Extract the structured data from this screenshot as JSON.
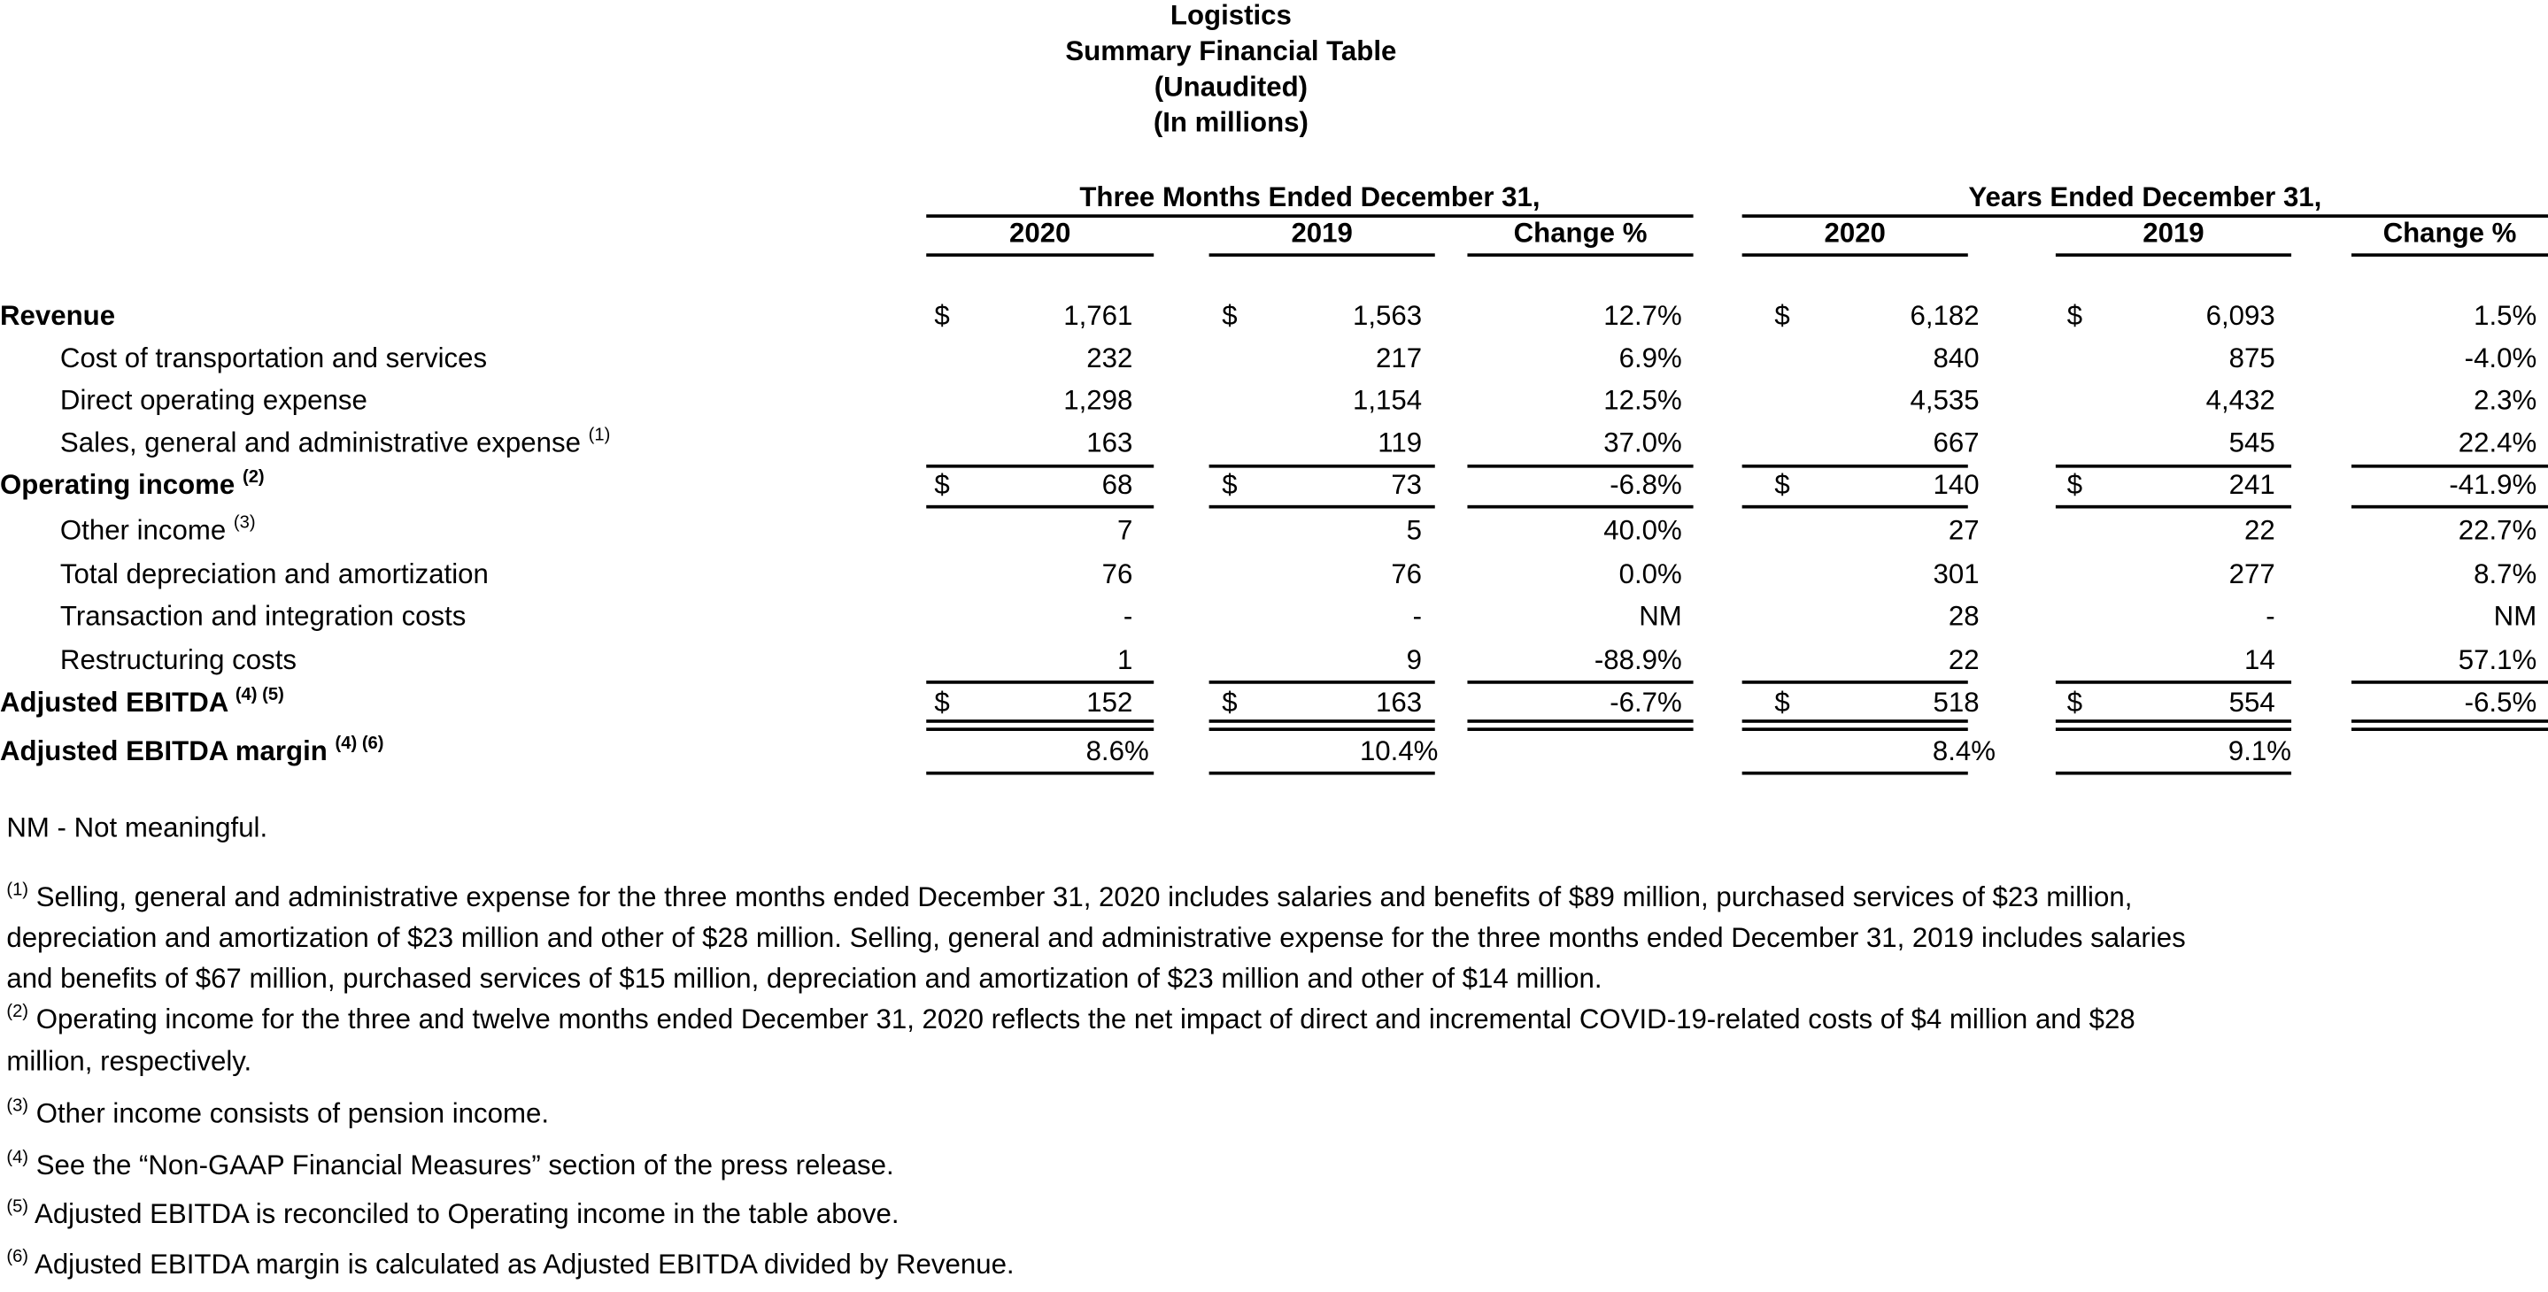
{
  "title": [
    "Logistics",
    "Summary Financial Table",
    "(Unaudited)",
    "(In millions)"
  ],
  "groups": [
    {
      "label": "Three Months Ended December 31,",
      "columns": [
        "2020",
        "2019",
        "Change %"
      ]
    },
    {
      "label": "Years Ended December 31,",
      "columns": [
        "2020",
        "2019",
        "Change %"
      ]
    }
  ],
  "currency_symbol": "$",
  "rows": [
    {
      "label": "Revenue",
      "note": "",
      "bold": true,
      "indent": false,
      "dollar": true,
      "values": [
        "1,761",
        "1,563",
        "12.7%",
        "6,182",
        "6,093",
        "1.5%"
      ]
    },
    {
      "label": "Cost of transportation and services",
      "note": "",
      "bold": false,
      "indent": true,
      "dollar": false,
      "values": [
        "232",
        "217",
        "6.9%",
        "840",
        "875",
        "-4.0%"
      ]
    },
    {
      "label": "Direct operating expense",
      "note": "",
      "bold": false,
      "indent": true,
      "dollar": false,
      "values": [
        "1,298",
        "1,154",
        "12.5%",
        "4,535",
        "4,432",
        "2.3%"
      ]
    },
    {
      "label": "Sales, general and administrative expense",
      "note": "(1)",
      "bold": false,
      "indent": true,
      "dollar": false,
      "values": [
        "163",
        "119",
        "37.0%",
        "667",
        "545",
        "22.4%"
      ]
    },
    {
      "label": "Operating income",
      "note": "(2)",
      "bold": true,
      "indent": false,
      "dollar": true,
      "values": [
        "68",
        "73",
        "-6.8%",
        "140",
        "241",
        "-41.9%"
      ]
    },
    {
      "label": "Other income",
      "note": "(3)",
      "bold": false,
      "indent": true,
      "dollar": false,
      "values": [
        "7",
        "5",
        "40.0%",
        "27",
        "22",
        "22.7%"
      ]
    },
    {
      "label": "Total depreciation and amortization",
      "note": "",
      "bold": false,
      "indent": true,
      "dollar": false,
      "values": [
        "76",
        "76",
        "0.0%",
        "301",
        "277",
        "8.7%"
      ]
    },
    {
      "label": "Transaction and integration costs",
      "note": "",
      "bold": false,
      "indent": true,
      "dollar": false,
      "values": [
        "-",
        "-",
        "NM",
        "28",
        "-",
        "NM"
      ]
    },
    {
      "label": "Restructuring costs",
      "note": "",
      "bold": false,
      "indent": true,
      "dollar": false,
      "values": [
        "1",
        "9",
        "-88.9%",
        "22",
        "14",
        "57.1%"
      ]
    },
    {
      "label": "Adjusted EBITDA",
      "note": "(4) (5)",
      "bold": true,
      "indent": false,
      "dollar": true,
      "values": [
        "152",
        "163",
        "-6.7%",
        "518",
        "554",
        "-6.5%"
      ]
    },
    {
      "label": "Adjusted EBITDA margin",
      "note": "(4) (6)",
      "bold": true,
      "indent": false,
      "dollar": false,
      "values": [
        "8.6%",
        "10.4%",
        "",
        "8.4%",
        "9.1%",
        ""
      ]
    }
  ],
  "nm_note": "NM - Not meaningful.",
  "footnotes": [
    {
      "mark": "(1)",
      "lines": [
        "Selling, general and administrative expense for the three months ended December 31, 2020 includes salaries and benefits of $89 million, purchased services of $23 million,",
        "depreciation and amortization of $23 million and other of $28 million. Selling, general and administrative expense for the three months ended December 31, 2019 includes salaries",
        "and benefits of $67 million, purchased services of $15 million, depreciation and amortization of $23 million and other of $14 million."
      ]
    },
    {
      "mark": "(2)",
      "lines": [
        "Operating income for the three and twelve months ended December 31, 2020 reflects the net impact of direct and incremental COVID-19-related costs of $4 million and $28",
        "million, respectively."
      ]
    },
    {
      "mark": "(3)",
      "lines": [
        "Other income consists of pension income."
      ]
    },
    {
      "mark": "(4)",
      "lines": [
        "See the “Non-GAAP Financial Measures” section of the press release."
      ]
    },
    {
      "mark": "(5)",
      "lines": [
        "Adjusted EBITDA is reconciled to Operating income in the table above."
      ]
    },
    {
      "mark": "(6)",
      "lines": [
        "Adjusted EBITDA margin is calculated as Adjusted EBITDA divided by Revenue."
      ]
    }
  ]
}
